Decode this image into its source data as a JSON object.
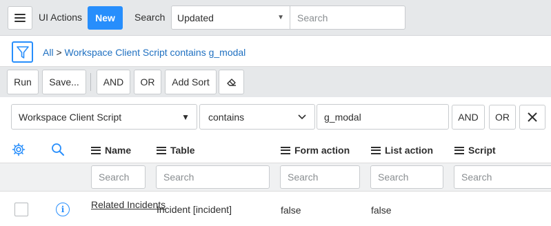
{
  "header": {
    "menu_icon": "hamburger-icon",
    "title": "UI Actions",
    "new_label": "New",
    "search_label": "Search",
    "field_select": "Updated",
    "search_placeholder": "Search"
  },
  "breadcrumb": {
    "filter_icon": "funnel-icon",
    "all_label": "All",
    "separator": ">",
    "condition": "Workspace Client Script contains g_modal"
  },
  "toolbar": {
    "run": "Run",
    "save": "Save...",
    "and": "AND",
    "or": "OR",
    "add_sort": "Add Sort",
    "clear_icon": "eraser-icon"
  },
  "condition_row": {
    "field": "Workspace Client Script",
    "operator": "contains",
    "value": "g_modal",
    "and": "AND",
    "or": "OR",
    "remove_icon": "close-icon"
  },
  "table": {
    "settings_icon": "gear-icon",
    "search_icon": "search-icon",
    "columns": [
      "Name",
      "Table",
      "Form action",
      "List action",
      "Script"
    ],
    "search_placeholder": "Search",
    "rows": [
      {
        "name": "Related Incidents",
        "table": "Incident [incident]",
        "form_action": "false",
        "list_action": "false",
        "script": ""
      }
    ]
  },
  "colors": {
    "accent": "#278efc",
    "link": "#1f70c1",
    "header_bg": "#e6e8ea"
  }
}
